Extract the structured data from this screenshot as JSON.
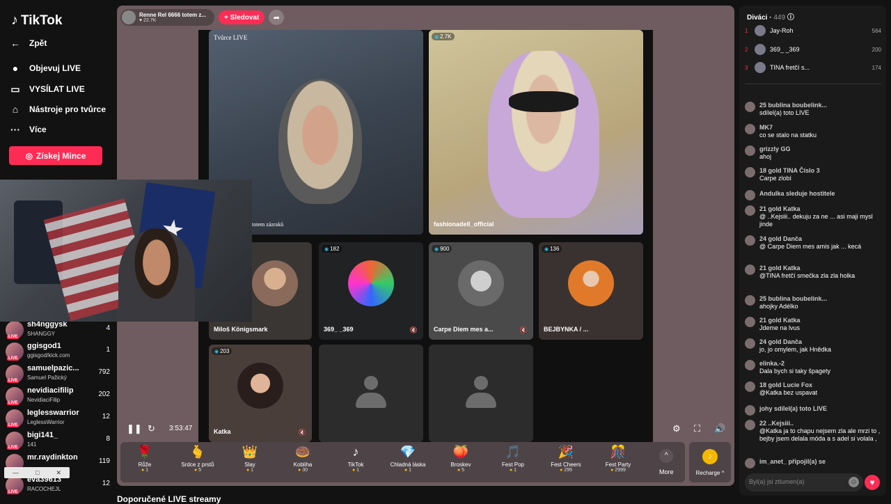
{
  "sidebar": {
    "logo": "TikTok",
    "nav": [
      {
        "label": "Zpět",
        "icon": "←"
      },
      {
        "label": "Objevuj LIVE",
        "icon": "●"
      },
      {
        "label": "VYSÍLAT LIVE",
        "icon": "▭"
      },
      {
        "label": "Nástroje pro tvůrce",
        "icon": "⌂"
      },
      {
        "label": "Více",
        "icon": "···"
      }
    ],
    "coins_button": "Získej Mince",
    "suggested": [
      {
        "name": "sh4nggysk",
        "sub": "SHANGGY",
        "count": "4"
      },
      {
        "name": "ggisgod1",
        "sub": "ggisgod/kick.com",
        "count": "1"
      },
      {
        "name": "samuelpazic...",
        "sub": "Samuel Pažický",
        "count": "792"
      },
      {
        "name": "nevidiacifilip",
        "sub": "NevidiaciFilip",
        "count": "202"
      },
      {
        "name": "leglesswarrior",
        "sub": "LeglessWarrior",
        "count": "12"
      },
      {
        "name": "bigi141_",
        "sub": "141",
        "count": "8"
      },
      {
        "name": "mr.raydinkton",
        "sub": "",
        "count": "119"
      },
      {
        "name": "eva39613",
        "sub": "RACOCHEJL",
        "count": "12"
      }
    ]
  },
  "stream": {
    "host_name": "Renne Rel 6666 totem z...",
    "host_likes": "22.7K",
    "follow_label": "+ Sledovat",
    "tiles": [
      {
        "label": "Tvůrce LIVE",
        "caption": "totem zázraků",
        "count": ""
      },
      {
        "label": "fashionadell_official",
        "count": "2.7K"
      },
      {
        "label": "Miloš Königsmark",
        "count": ""
      },
      {
        "label": "369_ _369",
        "count": "182"
      },
      {
        "label": "Carpe Diem mes a...",
        "count": "900"
      },
      {
        "label": "BEJBYNKA / ...",
        "count": "136"
      },
      {
        "label": "Katka",
        "count": "203"
      }
    ],
    "time": "3:53:47"
  },
  "gifts": [
    {
      "name": "Růže",
      "price": "1",
      "icon": "🌹"
    },
    {
      "name": "Srdce z prstů",
      "price": "5",
      "icon": "🫰"
    },
    {
      "name": "Slay",
      "price": "1",
      "icon": "👑"
    },
    {
      "name": "Kobliha",
      "price": "30",
      "icon": "🍩"
    },
    {
      "name": "TikTok",
      "price": "1",
      "icon": "♪"
    },
    {
      "name": "Chladná láska",
      "price": "1",
      "icon": "💎"
    },
    {
      "name": "Broskev",
      "price": "5",
      "icon": "🍑"
    },
    {
      "name": "Fest Pop",
      "price": "1",
      "icon": "🎵"
    },
    {
      "name": "Fest Cheers",
      "price": "299",
      "icon": "🎉"
    },
    {
      "name": "Fest Party",
      "price": "2999",
      "icon": "🎊"
    }
  ],
  "more_label": "More",
  "recharge_label": "Recharge ^",
  "recommended_title": "Doporučené LIVE streamy",
  "chat": {
    "viewers_label": "Diváci",
    "viewers_count": "449",
    "top_viewers": [
      {
        "rank": "1",
        "name": "Jay-Roh",
        "score": "564"
      },
      {
        "rank": "2",
        "name": "369_ _369",
        "score": "200"
      },
      {
        "rank": "3",
        "name": "TINA fretčí s...",
        "score": "174"
      }
    ],
    "messages": [
      {
        "head": "25 bublina boubelink...",
        "text": "sdílel(a) toto LIVE"
      },
      {
        "head": "MK7",
        "text": "co se stalo na statku"
      },
      {
        "head": "grizzly GG",
        "text": "ahoj"
      },
      {
        "head": "18 gold TINA Číslo 3",
        "text": "Carpe zlobí"
      },
      {
        "head": "Andulka sleduje hostitele",
        "text": ""
      },
      {
        "head": "21 gold Katka",
        "text": "@ ..Kejsiii.. dekuju za ne ... asi maji mysl jinde"
      },
      {
        "head": "24 gold Danča",
        "text": "@ Carpe Diem mes amis jak ... kecá"
      },
      {
        "head": "21 gold Katka",
        "text": "@TINA fretčí smečka zla zla holka"
      },
      {
        "head": "25 bublina boubelink...",
        "text": "ahojky Adélko"
      },
      {
        "head": "21 gold Katka",
        "text": "Jdeme na lvus"
      },
      {
        "head": "24 gold Danča",
        "text": "jo, jo omylem, jak Hnědka"
      },
      {
        "head": "elinka.-2",
        "text": "Dala bych si taky špagety"
      },
      {
        "head": "18 gold Lucie Fox",
        "text": "@Katka bez uspavat"
      },
      {
        "head": "johy sdílel(a) toto LIVE",
        "text": ""
      },
      {
        "head": "22 ..Kejsiii..",
        "text": "@Katka ja to chapu nejsem zla ale mrzi to , bejby jsem delala móda a s adel si volala ,"
      },
      {
        "head": "im_anet_ připojil(a) se",
        "text": ""
      }
    ],
    "input_placeholder": "Byl(a) jsi ztlumen(a)"
  }
}
